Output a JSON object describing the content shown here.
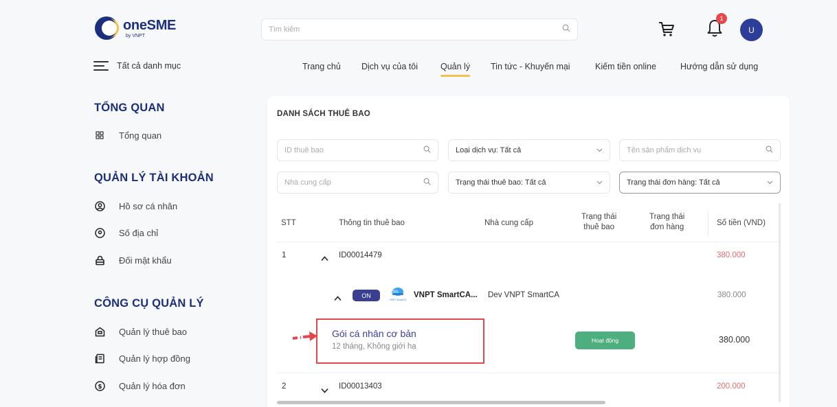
{
  "brand": {
    "name": "oneSME",
    "sub": "by VNPT"
  },
  "search": {
    "placeholder": "Tìm kiếm"
  },
  "notifications": {
    "count": "1"
  },
  "user": {
    "initial": "U"
  },
  "category": {
    "label": "Tất cả danh mục"
  },
  "nav": {
    "items": [
      "Trang chủ",
      "Dịch vụ của tôi",
      "Quản lý",
      "Tin tức - Khuyến mại",
      "Kiếm tiền online",
      "Hướng dẫn sử dụng"
    ],
    "active": "Quản lý"
  },
  "sidebar": {
    "overview_heading": "TỔNG QUAN",
    "overview_item": "Tổng quan",
    "account_heading": "QUẢN LÝ TÀI KHOẢN",
    "account_items": [
      "Hồ sơ cá nhân",
      "Số địa chỉ",
      "Đối mật khẩu"
    ],
    "tools_heading": "CÔNG CỤ QUẢN LÝ",
    "tools_items": [
      "Quản lý thuê bao",
      "Quản lý hợp đồng",
      "Quản lý hóa đơn"
    ]
  },
  "panel": {
    "title": "DANH SÁCH THUÊ BAO",
    "filters": {
      "id_placeholder": "ID thuê bao",
      "service_type": "Loại dịch vụ: Tất cả",
      "product_placeholder": "Tên sản phẩm dịch vụ",
      "provider_placeholder": "Nhà cung cấp",
      "subscription_status": "Trạng thái thuê bao: Tất cả",
      "order_status": "Trạng thái đơn hàng: Tất cả"
    },
    "columns": {
      "stt": "STT",
      "info": "Thông tin thuê bao",
      "provider": "Nhà cung cấp",
      "sub_status_1": "Trạng thái",
      "sub_status_2": "thuê bao",
      "order_status_1": "Trạng thái",
      "order_status_2": "đơn hàng",
      "amount": "Số tiền (VND)"
    },
    "rows": [
      {
        "stt": "1",
        "id": "ID00014479",
        "amount": "380.000",
        "service": {
          "toggle": "ON",
          "name": "VNPT SmartCA...",
          "provider": "Dev VNPT SmartCA",
          "amount": "380.000",
          "logo_text": "VNPT SmartCA"
        },
        "package": {
          "name": "Gói cá nhân cơ bản",
          "detail": "12 tháng, Không giới hạ",
          "status": "Hoạt động",
          "amount": "380.000"
        }
      },
      {
        "stt": "2",
        "id": "ID00013403",
        "amount": "200.000"
      }
    ]
  },
  "colors": {
    "brand": "#1b2f78",
    "active_underline": "#f2c14e",
    "status_green": "#4caf7d",
    "highlight_red": "#e0464b"
  }
}
